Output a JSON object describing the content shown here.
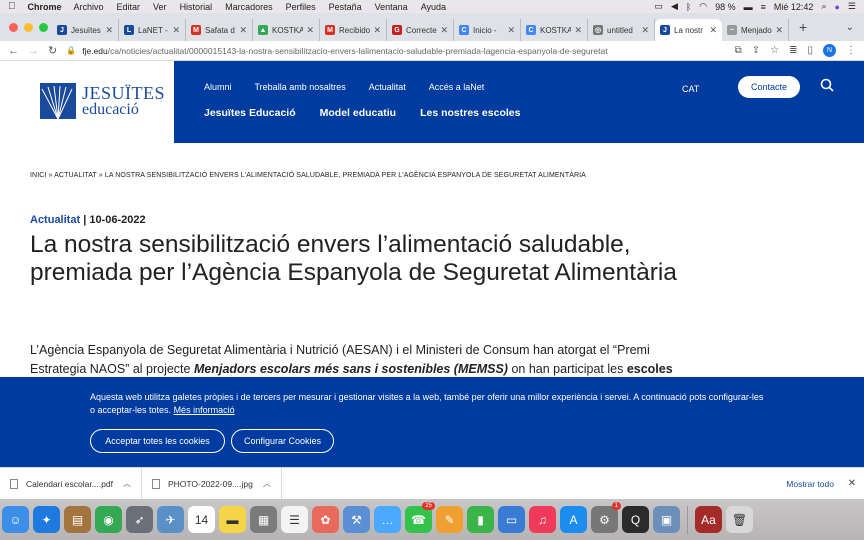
{
  "menubar": {
    "app": "Chrome",
    "items": [
      "Archivo",
      "Editar",
      "Ver",
      "Historial",
      "Marcadores",
      "Perfiles",
      "Pestaña",
      "Ventana",
      "Ayuda"
    ],
    "battery": "98 %",
    "datetime": "Mié 12:42"
  },
  "tabs": [
    {
      "label": "Jesuïtes",
      "color": "#1a4a9c",
      "glyph": "J"
    },
    {
      "label": "LaNET -",
      "color": "#1a4a9c",
      "glyph": "L"
    },
    {
      "label": "Safata d",
      "color": "#d93025",
      "glyph": "M"
    },
    {
      "label": "KOSTKA",
      "color": "#34a853",
      "glyph": "▲"
    },
    {
      "label": "Recibido",
      "color": "#d93025",
      "glyph": "M"
    },
    {
      "label": "Correcte",
      "color": "#c5221f",
      "glyph": "G"
    },
    {
      "label": "Inicio - ",
      "color": "#4285f4",
      "glyph": "C"
    },
    {
      "label": "KOSTKA",
      "color": "#4285f4",
      "glyph": "C"
    },
    {
      "label": "untitled",
      "color": "#777777",
      "glyph": "◎"
    },
    {
      "label": "La nostr",
      "color": "#1a4a9c",
      "glyph": "J",
      "active": true
    },
    {
      "label": "Menjado",
      "color": "#999999",
      "glyph": "~"
    }
  ],
  "address": {
    "host": "fje.edu",
    "path": "/ca/noticies/actualitat/0000015143-la-nostra-sensibilitzacio-envers-lalimentacio-saludable-premiada-lagencia-espanyola-de-seguretat",
    "profile_initial": "N"
  },
  "site": {
    "logo_line1": "JESUÏTES",
    "logo_line2": "educació",
    "topnav": [
      "Alumni",
      "Treballa amb nosaltres",
      "Actualitat",
      "Accés a laNet"
    ],
    "mainnav": [
      "Jesuïtes Educació",
      "Model educatiu",
      "Les nostres escoles"
    ],
    "lang": "CAT",
    "contact": "Contacte"
  },
  "article": {
    "breadcrumb": "Inici » Actualitat » La nostra sensibilització envers l'alimentació saludable, premiada per l'Agència Espanyola de Seguretat Alimentària",
    "category": "Actualitat",
    "date": "| 10-06-2022",
    "title": "La nostra sensibilització envers l’alimentació saludable, premiada per l’Agència Espanyola de Seguretat Alimentària",
    "body_part1": "L’Agència Espanyola de Seguretat Alimentària i Nutrició (AESAN) i el Ministeri de Consum han atorgat el “Premi Estrategia NAOS” al projecte ",
    "body_bold": "Menjadors escolars més sans i sostenibles (MEMSS)",
    "body_part2": " on han participat les ",
    "body_bold2": "escoles"
  },
  "cookie": {
    "text": "Aquesta web utilitza galetes pròpies i de tercers per mesurar i gestionar visites a la web, també per oferir una millor experiència i servei. A continuació pots configurar-les o acceptar-les totes.",
    "link": "Més informació",
    "accept": "Acceptar totes les cookies",
    "configure": "Configurar Cookies"
  },
  "downloads": {
    "items": [
      "Calendari escolar....pdf",
      "PHOTO-2022-09....jpg"
    ],
    "show_all": "Mostrar todo"
  },
  "dock": {
    "icons": [
      {
        "name": "finder-icon",
        "color": "#3b8fe8",
        "glyph": "☺"
      },
      {
        "name": "safari-icon",
        "color": "#1f7ae0",
        "glyph": "✦"
      },
      {
        "name": "notes-book-icon",
        "color": "#a4743f",
        "glyph": "▤"
      },
      {
        "name": "chrome-icon",
        "color": "#34a853",
        "glyph": "◉"
      },
      {
        "name": "launchpad-icon",
        "color": "#6b6f78",
        "glyph": "➶"
      },
      {
        "name": "preview-icon",
        "color": "#5b8fc8",
        "glyph": "✈"
      },
      {
        "name": "calendar-icon",
        "color": "#ffffff",
        "glyph": "14"
      },
      {
        "name": "stickies-icon",
        "color": "#f5d547",
        "glyph": "▬"
      },
      {
        "name": "calculator-icon",
        "color": "#7b7b7b",
        "glyph": "▦"
      },
      {
        "name": "reminders-icon",
        "color": "#f4f4f4",
        "glyph": "☰"
      },
      {
        "name": "photos-icon",
        "color": "#e86a5c",
        "glyph": "✿"
      },
      {
        "name": "tools-icon",
        "color": "#5a8fd6",
        "glyph": "⚒"
      },
      {
        "name": "messages-icon",
        "color": "#4aa8ff",
        "glyph": "…"
      },
      {
        "name": "facetime-icon",
        "color": "#33c24a",
        "glyph": "☎",
        "badge": "25"
      },
      {
        "name": "pages-icon",
        "color": "#f0a030",
        "glyph": "✎"
      },
      {
        "name": "numbers-icon",
        "color": "#3bb54a",
        "glyph": "▮"
      },
      {
        "name": "keynote-icon",
        "color": "#3a7bd5",
        "glyph": "▭"
      },
      {
        "name": "music-icon",
        "color": "#f03a5a",
        "glyph": "♫"
      },
      {
        "name": "app-store-icon",
        "color": "#1d8cf0",
        "glyph": "A"
      },
      {
        "name": "system-preferences-icon",
        "color": "#777777",
        "glyph": "⚙",
        "badge": "1"
      },
      {
        "name": "quicktime-icon",
        "color": "#2b2b2b",
        "glyph": "Q"
      },
      {
        "name": "image-capture-icon",
        "color": "#6b8fb8",
        "glyph": "▣"
      },
      {
        "name": "dictionary-icon",
        "color": "#a52a2a",
        "glyph": "Aa"
      },
      {
        "name": "trash-icon",
        "color": "#d8d8d8",
        "glyph": "🗑"
      }
    ]
  }
}
